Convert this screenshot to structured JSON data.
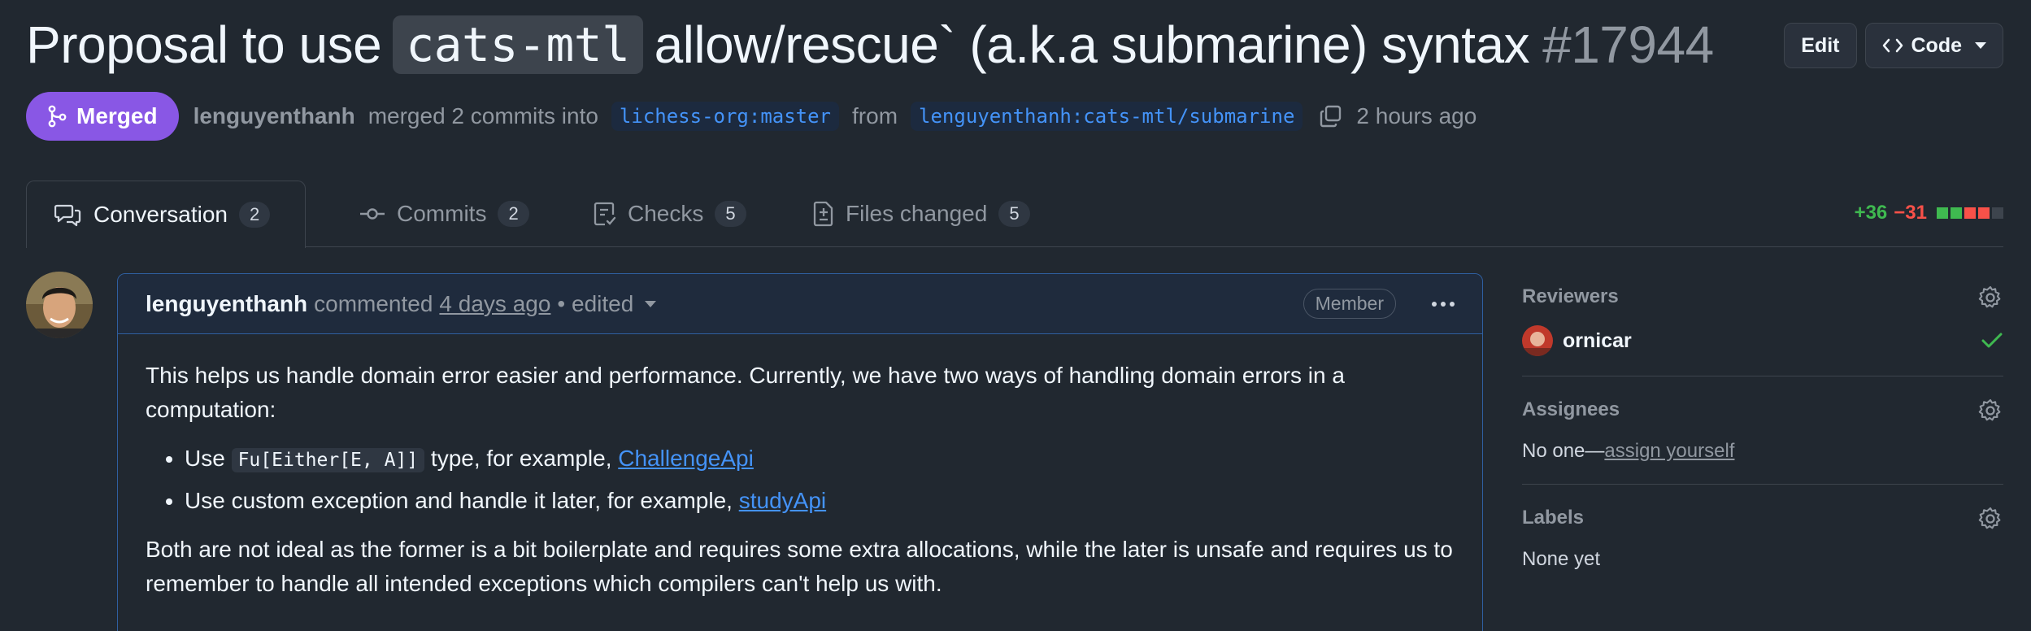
{
  "header": {
    "title_pre": "Proposal to use",
    "title_code": "cats-mtl",
    "title_post": "allow/rescue` (a.k.a submarine) syntax",
    "number": "#17944",
    "edit_label": "Edit",
    "code_label": "Code"
  },
  "meta": {
    "status": "Merged",
    "author": "lenguyenthanh",
    "action": "merged 2 commits into",
    "base_branch": "lichess-org:master",
    "from_word": "from",
    "head_branch": "lenguyenthanh:cats-mtl/submarine",
    "time": "2 hours ago"
  },
  "tabs": [
    {
      "label": "Conversation",
      "count": "2"
    },
    {
      "label": "Commits",
      "count": "2"
    },
    {
      "label": "Checks",
      "count": "5"
    },
    {
      "label": "Files changed",
      "count": "5"
    }
  ],
  "diffstat": {
    "additions": "+36",
    "deletions": "−31"
  },
  "comment": {
    "author": "lenguyenthanh",
    "verb": "commented",
    "when": "4 days ago",
    "edited": "• edited",
    "badge": "Member",
    "p1": "This helps us handle domain error easier and performance. Currently, we have two ways of handling domain errors in a computation:",
    "li1_pre": "Use",
    "li1_code": "Fu[Either[E, A]]",
    "li1_mid": "type, for example,",
    "li1_link": "ChallengeApi",
    "li2_pre": "Use custom exception and handle it later, for example,",
    "li2_link": "studyApi",
    "p2": "Both are not ideal as the former is a bit boilerplate and requires some extra allocations, while the later is unsafe and requires us to remember to handle all intended exceptions which compilers can't help us with."
  },
  "sidebar": {
    "reviewers_title": "Reviewers",
    "reviewer_name": "ornicar",
    "assignees_title": "Assignees",
    "assignees_none": "No one—",
    "assign_link": "assign yourself",
    "labels_title": "Labels",
    "labels_none": "None yet"
  },
  "colors": {
    "merged": "#8957e5",
    "link": "#4493f8",
    "add": "#3fb950",
    "del": "#f85149"
  }
}
